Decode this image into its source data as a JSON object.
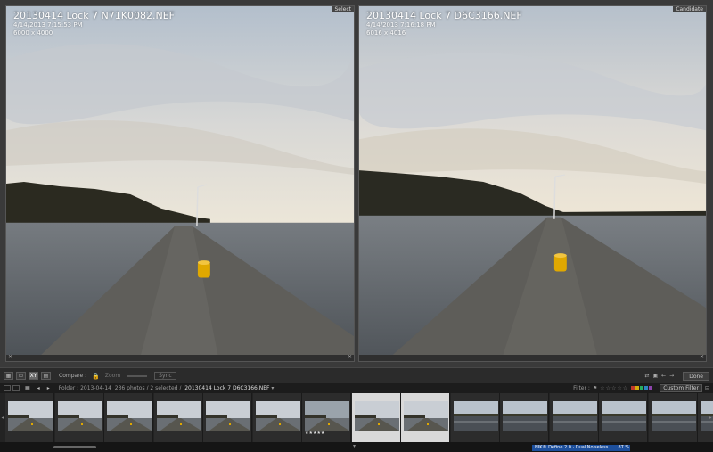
{
  "left_pane": {
    "badge": "Select",
    "filename": "20130414 Lock 7 N71K0082.NEF",
    "datetime": "4/14/2013 7:15:53 PM",
    "dimensions": "6000 x 4000",
    "close_glyph": "✕"
  },
  "right_pane": {
    "badge": "Candidate",
    "filename": "20130414 Lock 7 D6C3166.NEF",
    "datetime": "4/14/2013 7:16:18 PM",
    "dimensions": "6016 x 4016",
    "close_glyph": "✕"
  },
  "toolbar": {
    "compare_label": "Compare :",
    "zoom_label": "Zoom",
    "swap_label": "Sync",
    "done_label": "Done",
    "view_icons": [
      "grid-view-icon",
      "loupe-view-icon",
      "compare-view-icon",
      "survey-view-icon"
    ],
    "lock_icon": "lock-icon"
  },
  "filmstrip_header": {
    "folder": "Folder : 2013-04-14",
    "count": "236 photos / 2 selected /",
    "current_file": "20130414 Lock 7 D6C3166.NEF",
    "filter_label": "Filter :",
    "filter_value": "Custom Filter",
    "flag_colors": [
      "#c0392b",
      "#d4ac0d",
      "#27ae60",
      "#2e86c1",
      "#8e44ad"
    ]
  },
  "filmstrip": {
    "thumbnails": [
      {
        "kind": "pier",
        "selected": false
      },
      {
        "kind": "pier",
        "selected": false
      },
      {
        "kind": "pier",
        "selected": false
      },
      {
        "kind": "pier",
        "selected": false
      },
      {
        "kind": "pier",
        "selected": false
      },
      {
        "kind": "pier",
        "selected": false
      },
      {
        "kind": "pier-dark",
        "selected": false,
        "stars": "★★★★★"
      },
      {
        "kind": "pier",
        "selected": true
      },
      {
        "kind": "pier",
        "selected": true
      },
      {
        "kind": "water",
        "selected": false
      },
      {
        "kind": "water",
        "selected": false
      },
      {
        "kind": "water",
        "selected": false
      },
      {
        "kind": "water",
        "selected": false
      },
      {
        "kind": "water",
        "selected": false
      },
      {
        "kind": "water",
        "selected": false
      }
    ],
    "left_arrow": "◂",
    "right_arrow": "▸"
  },
  "bottom": {
    "plugin_text": "NIK® Define 2.0 · Dual Noiseless ..... 87 %",
    "arrow": "▾"
  },
  "colors": {
    "accent_blue": "#1d4f9c",
    "selected_cell": "#d9d9d9",
    "bollard_yellow": "#e0a800"
  }
}
